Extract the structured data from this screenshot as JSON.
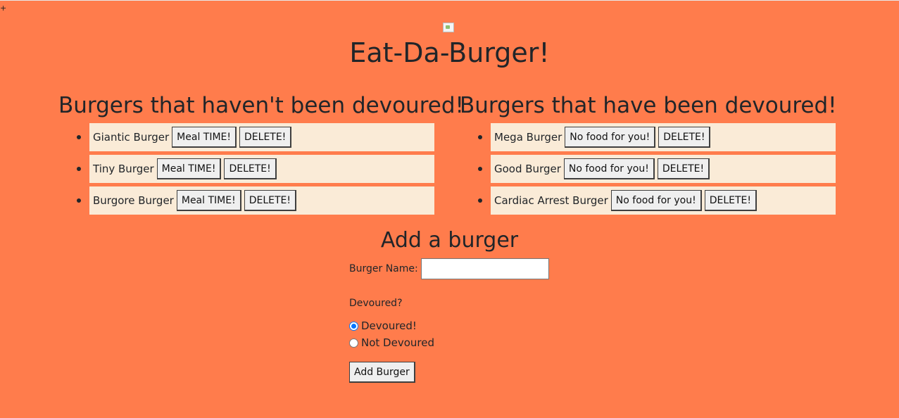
{
  "page": {
    "corner_mark": "+",
    "title": "Eat-Da-Burger!",
    "colors": {
      "background": "#ff7c4c",
      "item_background": "#faebd7"
    }
  },
  "left_column": {
    "heading": "Burgers that haven't been devoured!",
    "items": [
      {
        "name": "Giantic Burger",
        "action_label": "Meal TIME!",
        "delete_label": "DELETE!"
      },
      {
        "name": "Tiny Burger",
        "action_label": "Meal TIME!",
        "delete_label": "DELETE!"
      },
      {
        "name": "Burgore Burger",
        "action_label": "Meal TIME!",
        "delete_label": "DELETE!"
      }
    ]
  },
  "right_column": {
    "heading": "Burgers that have been devoured!",
    "items": [
      {
        "name": "Mega Burger",
        "action_label": "No food for you!",
        "delete_label": "DELETE!"
      },
      {
        "name": "Good Burger",
        "action_label": "No food for you!",
        "delete_label": "DELETE!"
      },
      {
        "name": "Cardiac Arrest Burger",
        "action_label": "No food for you!",
        "delete_label": "DELETE!"
      }
    ]
  },
  "form": {
    "heading": "Add a burger",
    "name_label": "Burger Name:",
    "name_value": "",
    "devoured_label": "Devoured?",
    "options": [
      {
        "label": "Devoured!",
        "checked": true
      },
      {
        "label": "Not Devoured",
        "checked": false
      }
    ],
    "submit_label": "Add Burger"
  }
}
